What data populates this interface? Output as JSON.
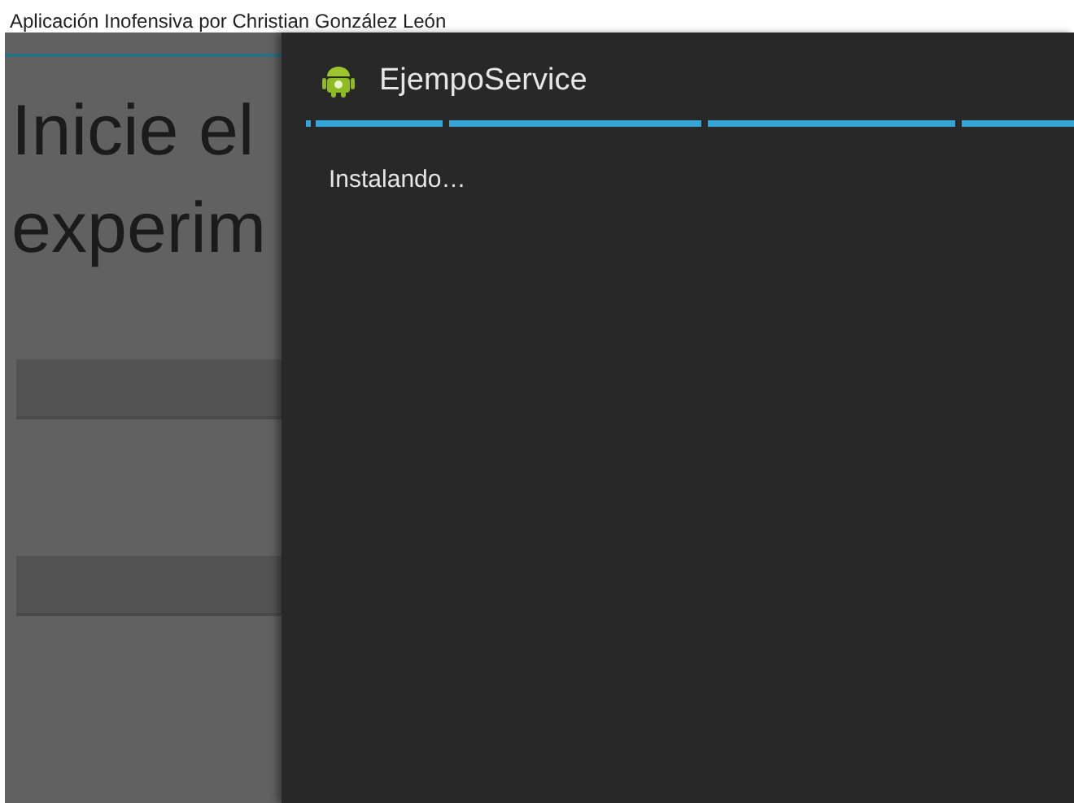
{
  "app_title": "Aplicación Inofensiva por Christian González León",
  "heading_lines": [
    "Inicie el",
    "experim"
  ],
  "fields": [
    {
      "kind": "text"
    },
    {
      "kind": "text"
    }
  ],
  "dialog": {
    "title": "EjempoService",
    "progress": {
      "indeterminate": true
    },
    "message": "Instalando…"
  }
}
